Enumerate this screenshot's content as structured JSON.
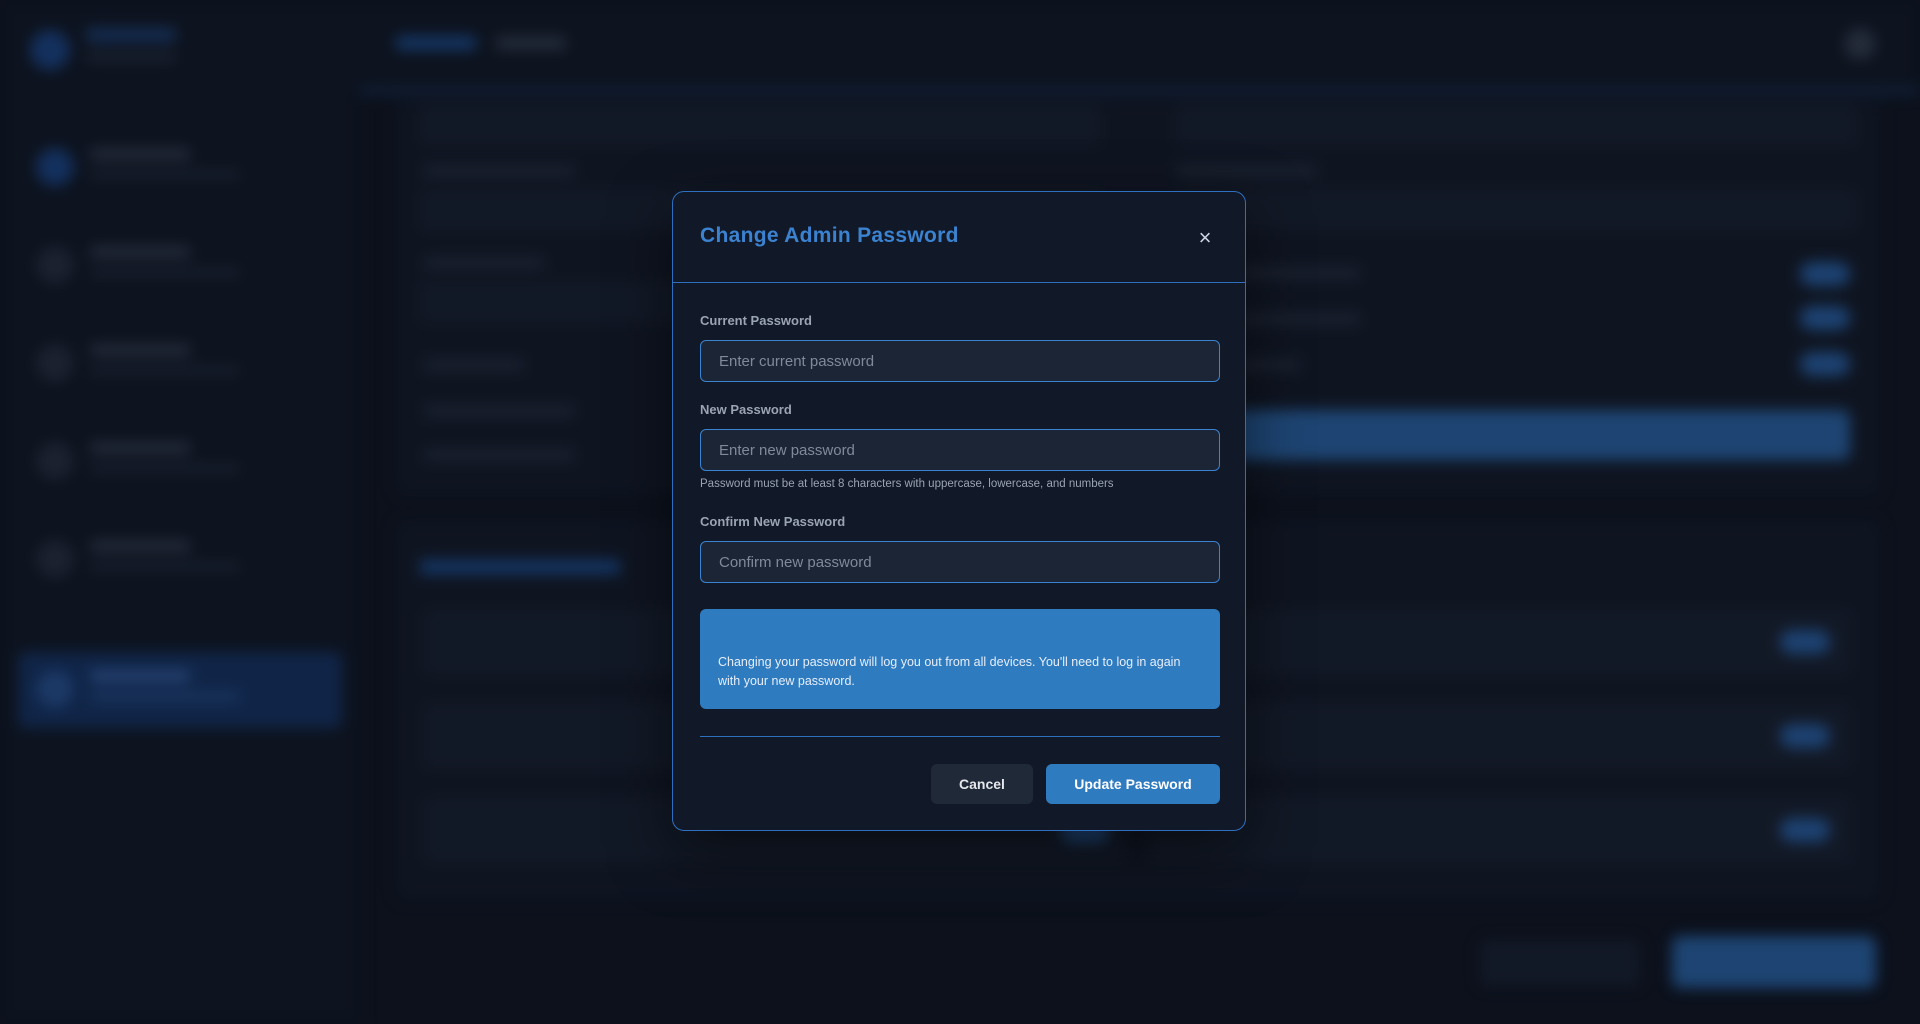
{
  "modal": {
    "title": "Change Admin Password",
    "close_symbol": "×",
    "current_password": {
      "label": "Current Password",
      "placeholder": "Enter current password"
    },
    "new_password": {
      "label": "New Password",
      "placeholder": "Enter new password",
      "hint": "Password must be at least 8 characters with uppercase, lowercase, and numbers"
    },
    "confirm_password": {
      "label": "Confirm New Password",
      "placeholder": "Confirm new password"
    },
    "info": "Changing your password will log you out from all devices. You'll need to log in again with your new password.",
    "buttons": {
      "cancel": "Cancel",
      "update": "Update Password"
    }
  },
  "colors": {
    "accent": "#3b82d0",
    "button_primary": "#2f7bc0",
    "modal_background": "#111827",
    "page_background": "#0f1623"
  },
  "icons": {
    "close": "close-icon"
  }
}
